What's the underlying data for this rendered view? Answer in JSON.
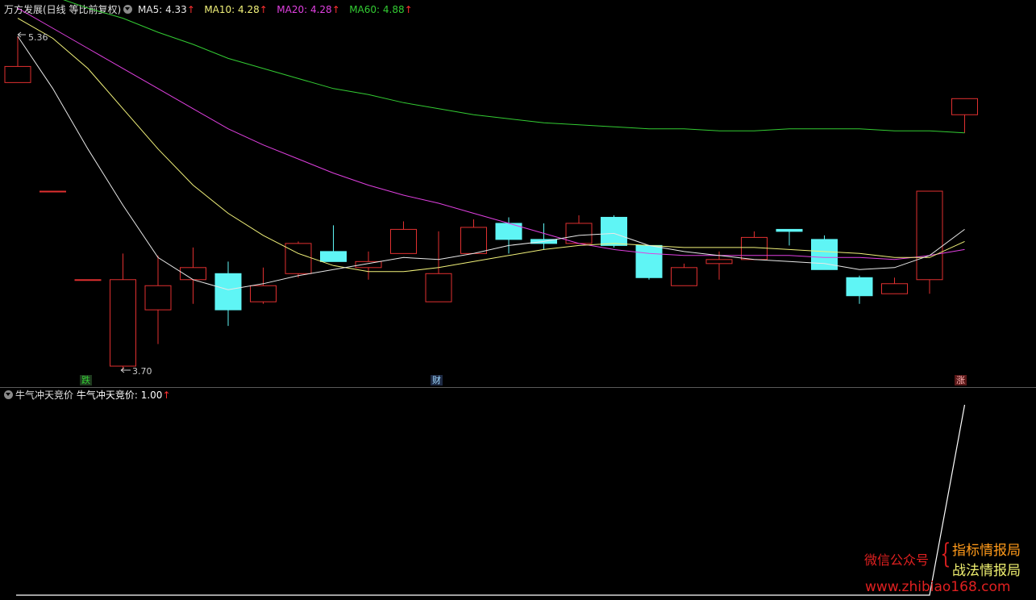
{
  "main_panel": {
    "title": "万方发展(日线 等比前复权)",
    "ma": [
      {
        "label": "MA5:",
        "value": "4.33",
        "arrow": "↑",
        "color": "#e8e8e8"
      },
      {
        "label": "MA10:",
        "value": "4.28",
        "arrow": "↑",
        "color": "#f2f27a"
      },
      {
        "label": "MA20:",
        "value": "4.28",
        "arrow": "↑",
        "color": "#e040e0"
      },
      {
        "label": "MA60:",
        "value": "4.88",
        "arrow": "↑",
        "color": "#33cc33"
      }
    ],
    "high_label": "5.36",
    "low_label": "3.70",
    "markers": {
      "down": "跌",
      "finance": "财",
      "up": "涨"
    }
  },
  "sub_panel": {
    "title": "牛气冲天竞价",
    "value_label": "牛气冲天竞价:",
    "value": "1.00",
    "arrow": "↑"
  },
  "watermark": {
    "wechat": "微信公众号",
    "line1": "指标情报局",
    "line2": "战法情报局",
    "url": "www.zhibiao168.com"
  },
  "colors": {
    "up_candle": "#e03030",
    "down_candle": "#5ff5f5",
    "ma5": "#e8e8e8",
    "ma10": "#f2f27a",
    "ma20": "#e040e0",
    "ma60": "#33cc33",
    "arrow": "#ff3030"
  },
  "chart_data": [
    {
      "type": "candlestick",
      "title": "万方发展(日线 等比前复权)",
      "price_range": [
        3.7,
        5.36
      ],
      "candles": [
        {
          "o": 5.13,
          "c": 5.21,
          "h": 5.36,
          "l": 5.13
        },
        {
          "o": 4.59,
          "c": 4.59,
          "h": 4.59,
          "l": 4.59
        },
        {
          "o": 4.15,
          "c": 4.15,
          "h": 4.15,
          "l": 4.15
        },
        {
          "o": 3.72,
          "c": 4.15,
          "h": 4.28,
          "l": 3.7
        },
        {
          "o": 4.0,
          "c": 4.12,
          "h": 4.27,
          "l": 3.83
        },
        {
          "o": 4.15,
          "c": 4.21,
          "h": 4.31,
          "l": 4.03
        },
        {
          "o": 4.18,
          "c": 4.0,
          "h": 4.24,
          "l": 3.92
        },
        {
          "o": 4.04,
          "c": 4.12,
          "h": 4.21,
          "l": 4.03
        },
        {
          "o": 4.18,
          "c": 4.33,
          "h": 4.34,
          "l": 4.16
        },
        {
          "o": 4.29,
          "c": 4.24,
          "h": 4.42,
          "l": 4.24
        },
        {
          "o": 4.21,
          "c": 4.24,
          "h": 4.29,
          "l": 4.15
        },
        {
          "o": 4.28,
          "c": 4.4,
          "h": 4.44,
          "l": 4.28
        },
        {
          "o": 4.04,
          "c": 4.18,
          "h": 4.39,
          "l": 4.04
        },
        {
          "o": 4.28,
          "c": 4.41,
          "h": 4.45,
          "l": 4.28
        },
        {
          "o": 4.43,
          "c": 4.35,
          "h": 4.46,
          "l": 4.28
        },
        {
          "o": 4.35,
          "c": 4.33,
          "h": 4.43,
          "l": 4.3
        },
        {
          "o": 4.33,
          "c": 4.43,
          "h": 4.47,
          "l": 4.33
        },
        {
          "o": 4.46,
          "c": 4.32,
          "h": 4.47,
          "l": 4.31
        },
        {
          "o": 4.32,
          "c": 4.16,
          "h": 4.32,
          "l": 4.15
        },
        {
          "o": 4.12,
          "c": 4.21,
          "h": 4.23,
          "l": 4.12
        },
        {
          "o": 4.23,
          "c": 4.25,
          "h": 4.29,
          "l": 4.15
        },
        {
          "o": 4.25,
          "c": 4.36,
          "h": 4.39,
          "l": 4.25
        },
        {
          "o": 4.4,
          "c": 4.39,
          "h": 4.4,
          "l": 4.32
        },
        {
          "o": 4.35,
          "c": 4.2,
          "h": 4.37,
          "l": 4.2
        },
        {
          "o": 4.16,
          "c": 4.07,
          "h": 4.17,
          "l": 4.03
        },
        {
          "o": 4.08,
          "c": 4.13,
          "h": 4.16,
          "l": 4.08
        },
        {
          "o": 4.15,
          "c": 4.59,
          "h": 4.59,
          "l": 4.08
        },
        {
          "o": 4.97,
          "c": 5.05,
          "h": 5.05,
          "l": 4.88
        }
      ],
      "ma5": [
        5.36,
        5.1,
        4.8,
        4.52,
        4.26,
        4.15,
        4.1,
        4.13,
        4.17,
        4.2,
        4.23,
        4.26,
        4.25,
        4.28,
        4.32,
        4.34,
        4.37,
        4.38,
        4.32,
        4.29,
        4.27,
        4.25,
        4.24,
        4.23,
        4.2,
        4.21,
        4.27,
        4.4
      ],
      "ma10": [
        5.45,
        5.35,
        5.2,
        5.0,
        4.8,
        4.62,
        4.48,
        4.37,
        4.28,
        4.22,
        4.19,
        4.19,
        4.21,
        4.24,
        4.27,
        4.3,
        4.32,
        4.33,
        4.32,
        4.31,
        4.31,
        4.31,
        4.3,
        4.29,
        4.28,
        4.26,
        4.26,
        4.34
      ],
      "ma20": [
        5.5,
        5.4,
        5.3,
        5.2,
        5.1,
        5.0,
        4.9,
        4.82,
        4.75,
        4.68,
        4.62,
        4.57,
        4.53,
        4.48,
        4.43,
        4.38,
        4.33,
        4.3,
        4.28,
        4.27,
        4.27,
        4.27,
        4.27,
        4.26,
        4.26,
        4.25,
        4.27,
        4.3
      ],
      "ma60": [
        5.6,
        5.56,
        5.5,
        5.45,
        5.38,
        5.32,
        5.25,
        5.2,
        5.15,
        5.1,
        5.07,
        5.03,
        5.0,
        4.97,
        4.95,
        4.93,
        4.92,
        4.91,
        4.9,
        4.9,
        4.89,
        4.89,
        4.9,
        4.9,
        4.9,
        4.89,
        4.89,
        4.88
      ]
    },
    {
      "type": "line",
      "title": "牛气冲天竞价",
      "series": [
        {
          "name": "牛气冲天竞价",
          "values": [
            0,
            0,
            0,
            0,
            0,
            0,
            0,
            0,
            0,
            0,
            0,
            0,
            0,
            0,
            0,
            0,
            0,
            0,
            0,
            0,
            0,
            0,
            0,
            0,
            0,
            0,
            0,
            1
          ]
        }
      ],
      "ylim": [
        0,
        1
      ]
    }
  ]
}
